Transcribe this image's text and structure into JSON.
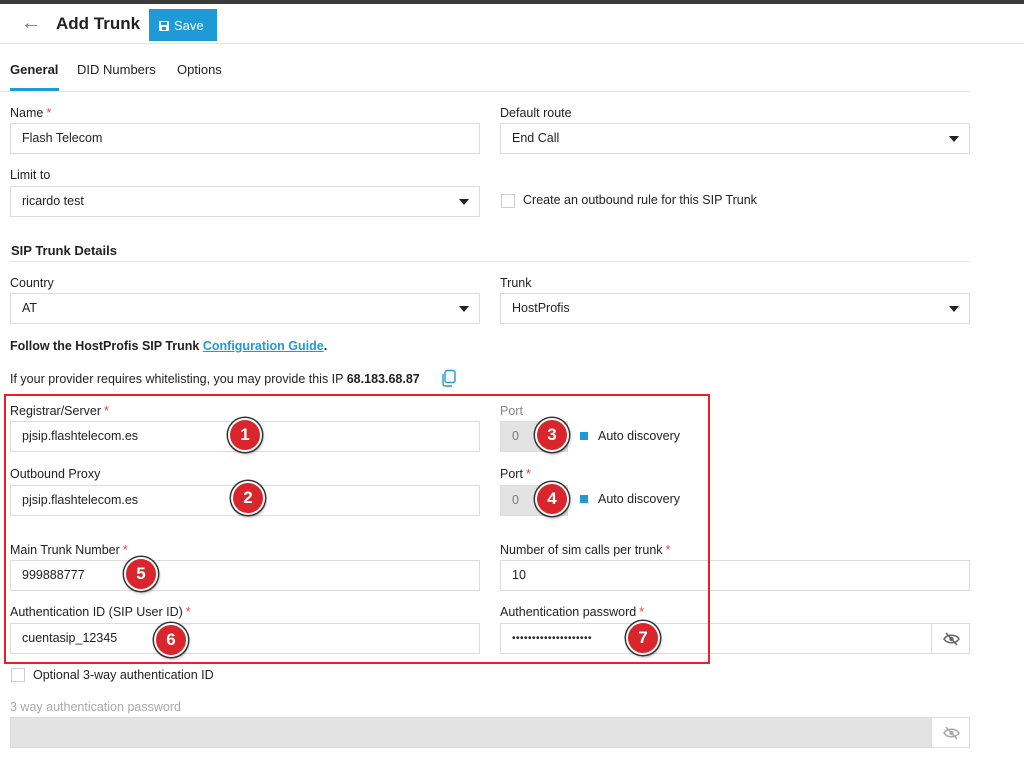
{
  "header": {
    "back_label": "←",
    "title": "Add Trunk",
    "save_label": "Save"
  },
  "tabs": [
    {
      "label": "General"
    },
    {
      "label": "DID Numbers"
    },
    {
      "label": "Options"
    }
  ],
  "general": {
    "name": {
      "label": "Name",
      "required": "*",
      "value": "Flash Telecom"
    },
    "default_route": {
      "label": "Default route",
      "value": "End Call"
    },
    "limit_to": {
      "label": "Limit to",
      "value": "ricardo test"
    },
    "outbound_rule": {
      "label": "Create an outbound rule for this SIP Trunk"
    }
  },
  "sip": {
    "section_title": "SIP Trunk Details",
    "country": {
      "label": "Country",
      "value": "AT"
    },
    "trunk": {
      "label": "Trunk",
      "value": "HostProfis"
    },
    "guide_prefix": "Follow the HostProfis SIP Trunk ",
    "guide_link": "Configuration Guide",
    "guide_suffix": ".",
    "whitelist_text": "If your provider requires whitelisting, you may provide this IP ",
    "whitelist_ip": "68.183.68.87",
    "registrar": {
      "label": "Registrar/Server",
      "required": "*",
      "value": "pjsip.flashtelecom.es"
    },
    "registrar_port": {
      "label": "Port",
      "value": "0"
    },
    "auto_discovery_1": "Auto discovery",
    "outbound_proxy": {
      "label": "Outbound Proxy",
      "value": "pjsip.flashtelecom.es"
    },
    "proxy_port": {
      "label": "Port",
      "required": "*",
      "value": "0"
    },
    "auto_discovery_2": "Auto discovery",
    "main_number": {
      "label": "Main Trunk Number",
      "required": "*",
      "value": "999888777"
    },
    "sim_calls": {
      "label": "Number of sim calls per trunk",
      "required": "*",
      "value": "10"
    },
    "auth_id": {
      "label": "Authentication ID (SIP User ID)",
      "required": "*",
      "value": "cuentasip_12345"
    },
    "auth_password": {
      "label": "Authentication password",
      "required": "*",
      "value": "••••••••••••••••••••"
    },
    "optional_3way": "Optional 3-way authentication ID",
    "three_way_password": {
      "label": "3 way authentication password",
      "value": ""
    }
  },
  "markers": [
    "1",
    "2",
    "3",
    "4",
    "5",
    "6",
    "7"
  ],
  "colors": {
    "accent": "#1e9ad6",
    "required": "#e0453f",
    "highlight_box": "#e8202a",
    "marker": "#d9262c"
  },
  "icons": {
    "back": "arrow-left-icon",
    "save": "floppy-disk-icon",
    "copy": "copy-icon",
    "eye": "eye-slash-icon",
    "dropdown": "caret-down-icon"
  }
}
